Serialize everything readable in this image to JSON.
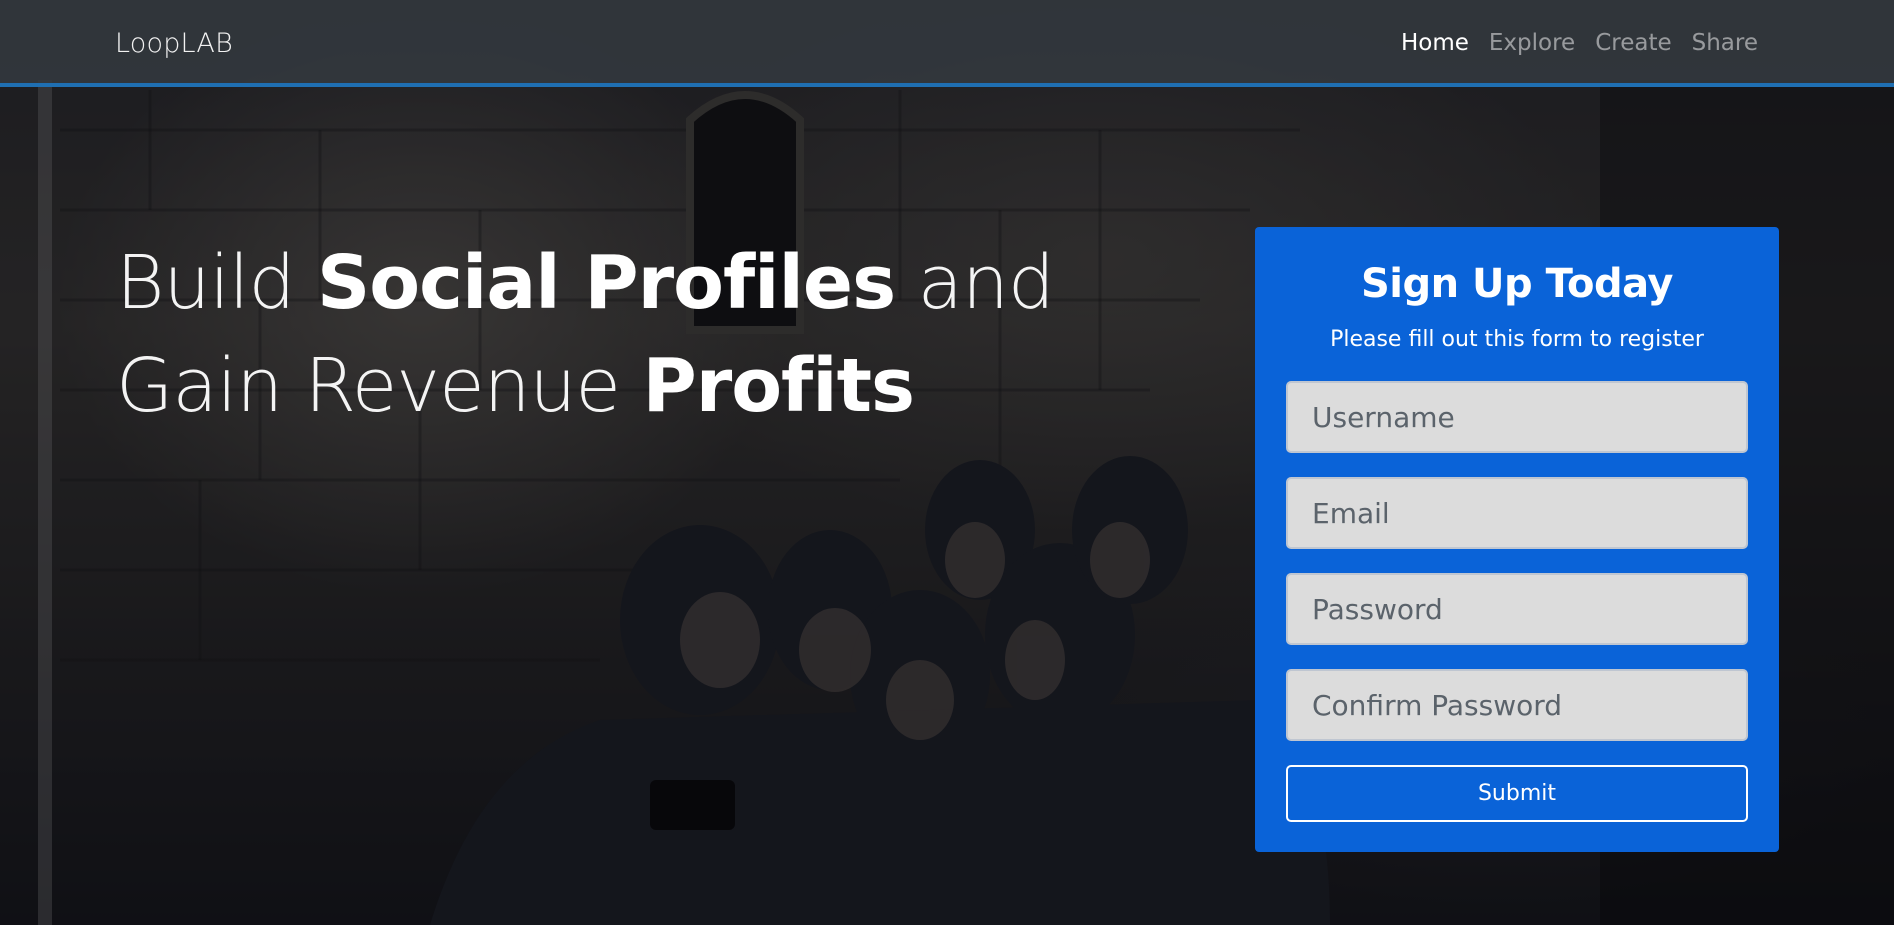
{
  "navbar": {
    "brand": "LoopLAB",
    "links": [
      {
        "label": "Home",
        "active": true
      },
      {
        "label": "Explore",
        "active": false
      },
      {
        "label": "Create",
        "active": false
      },
      {
        "label": "Share",
        "active": false
      }
    ],
    "accent_color": "#1f6fb2"
  },
  "hero": {
    "headline_parts": [
      {
        "text": "Build ",
        "weight": "thin"
      },
      {
        "text": "Social Profiles",
        "weight": "bold"
      },
      {
        "text": " and Gain Revenue ",
        "weight": "thin"
      },
      {
        "text": "Profits",
        "weight": "bold"
      }
    ],
    "background_image": "group-selfie-photo"
  },
  "signup": {
    "title": "Sign Up Today",
    "subtitle": "Please fill out this form to register",
    "fields": [
      {
        "name": "username",
        "placeholder": "Username",
        "value": ""
      },
      {
        "name": "email",
        "placeholder": "Email",
        "value": ""
      },
      {
        "name": "password",
        "placeholder": "Password",
        "value": ""
      },
      {
        "name": "confirm_password",
        "placeholder": "Confirm Password",
        "value": ""
      }
    ],
    "submit_label": "Submit",
    "card_color": "#0a63d8"
  }
}
